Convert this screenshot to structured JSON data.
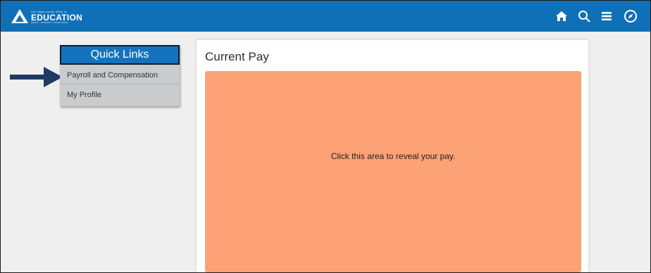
{
  "header": {
    "logo": {
      "small_text": "san diego county office of",
      "main_text": "EDUCATION",
      "tagline": "EQUITY · INTEGRITY · EXCELLENCE"
    },
    "nav_icons": [
      "home-icon",
      "search-icon",
      "menu-icon",
      "compass-icon"
    ],
    "bar_color": "#0f70b7"
  },
  "quick_links": {
    "title": "Quick Links",
    "items": [
      {
        "label": "Payroll and Compensation"
      },
      {
        "label": "My Profile"
      }
    ],
    "header_color": "#1573bd"
  },
  "current_pay": {
    "title": "Current Pay",
    "reveal_text": "Click this area to reveal your pay.",
    "reveal_color": "#fda177"
  },
  "annotation": {
    "arrow_color": "#1f3b63"
  }
}
